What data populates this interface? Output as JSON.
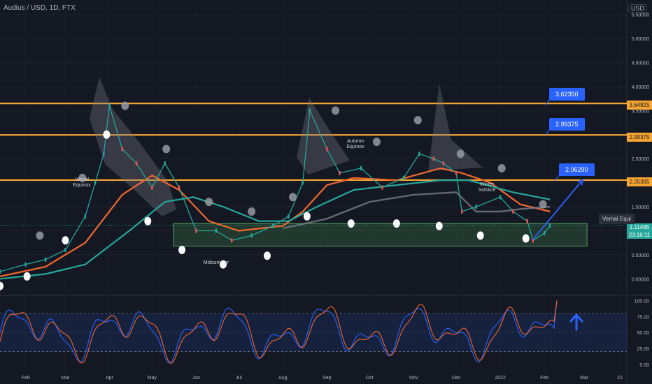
{
  "header": {
    "symbol": "Audius / USD, 1D, FTX",
    "currency": "USD"
  },
  "chart_data": [
    {
      "type": "line",
      "title": "Audius / USD, 1D, FTX",
      "x_axis": [
        "Feb",
        "Mar",
        "Apr",
        "May",
        "Jun",
        "Jul",
        "Aug",
        "Sep",
        "Oct",
        "Nov",
        "Dec",
        "2022",
        "Feb",
        "Mar",
        "22"
      ],
      "y_ticks": [
        "5.50000",
        "5.00000",
        "4.50000",
        "4.00000",
        "3.50000",
        "3.00000",
        "2.50000",
        "2.00000",
        "1.50000",
        "1.00000",
        "0.50000",
        "0.00000"
      ],
      "ylim": [
        -0.3,
        5.8
      ],
      "price": {
        "x": [
          "2021-01-14",
          "2021-02-01",
          "2021-02-15",
          "2021-03-01",
          "2021-03-15",
          "2021-03-22",
          "2021-03-28",
          "2021-04-01",
          "2021-04-10",
          "2021-04-20",
          "2021-05-01",
          "2021-05-10",
          "2021-05-20",
          "2021-06-01",
          "2021-06-15",
          "2021-06-26",
          "2021-07-10",
          "2021-07-25",
          "2021-08-05",
          "2021-08-15",
          "2021-08-20",
          "2021-09-01",
          "2021-09-10",
          "2021-09-25",
          "2021-10-10",
          "2021-10-25",
          "2021-11-05",
          "2021-11-15",
          "2021-11-22",
          "2021-12-01",
          "2021-12-05",
          "2021-12-15",
          "2022-01-01",
          "2022-01-10",
          "2022-01-20",
          "2022-01-24",
          "2022-02-01",
          "2022-02-05"
        ],
        "y": [
          0.15,
          0.3,
          0.4,
          0.6,
          1.3,
          2.0,
          2.6,
          3.6,
          2.7,
          2.4,
          1.9,
          2.4,
          1.9,
          1.0,
          1.0,
          0.8,
          0.9,
          1.1,
          1.3,
          2.0,
          3.5,
          2.7,
          2.2,
          2.3,
          1.9,
          2.1,
          2.6,
          2.5,
          2.4,
          2.2,
          1.4,
          1.5,
          1.7,
          1.4,
          1.2,
          0.8,
          0.95,
          1.11
        ]
      },
      "series": [
        {
          "color": "#f2672e",
          "x": [
            "2021-01-14",
            "2021-02-15",
            "2021-03-15",
            "2021-04-10",
            "2021-05-01",
            "2021-05-20",
            "2021-06-10",
            "2021-07-01",
            "2021-08-01",
            "2021-08-15",
            "2021-09-01",
            "2021-09-20",
            "2021-10-20",
            "2021-11-20",
            "2021-12-05",
            "2021-12-25",
            "2022-01-15",
            "2022-02-05"
          ],
          "y": [
            0.05,
            0.25,
            0.75,
            1.75,
            2.15,
            1.85,
            1.2,
            1.0,
            1.1,
            1.4,
            1.95,
            2.1,
            2.05,
            2.3,
            2.2,
            2.0,
            1.55,
            1.4
          ]
        },
        {
          "color": "#26a69a",
          "x": [
            "2021-01-14",
            "2021-02-15",
            "2021-03-15",
            "2021-04-15",
            "2021-05-10",
            "2021-05-30",
            "2021-06-20",
            "2021-07-15",
            "2021-08-05",
            "2021-08-25",
            "2021-09-20",
            "2021-10-20",
            "2021-11-20",
            "2021-12-10",
            "2022-01-10",
            "2022-02-05"
          ],
          "y": [
            0.0,
            0.1,
            0.3,
            1.0,
            1.6,
            1.7,
            1.5,
            1.2,
            1.2,
            1.5,
            1.85,
            1.95,
            2.05,
            2.05,
            1.8,
            1.65
          ]
        },
        {
          "color": "#787b86",
          "x": [
            "2021-08-01",
            "2021-09-01",
            "2021-10-01",
            "2021-11-01",
            "2021-12-01",
            "2021-12-15",
            "2022-01-01",
            "2022-01-15",
            "2022-02-05"
          ],
          "y": [
            1.05,
            1.25,
            1.6,
            1.75,
            1.8,
            1.4,
            1.4,
            1.45,
            1.5
          ]
        }
      ],
      "levels": [
        {
          "value": 3.64825,
          "label": "3.64825"
        },
        {
          "value": 2.99375,
          "label": "2.99375"
        },
        {
          "value": 2.05395,
          "label": "2.05395"
        }
      ],
      "callouts": [
        "3.62350",
        "2.99375",
        "2.06290"
      ],
      "accumulation_zone": {
        "low": 0.68,
        "high": 1.15
      },
      "forecast_arrow": {
        "from": [
          "2022-01-24",
          0.82
        ],
        "to": [
          "2022-02-28",
          2.06
        ]
      },
      "current_price": {
        "value": 1.11495,
        "label": "1.11495",
        "countdown": "23:16:11"
      },
      "annotations": [
        "Vernal Equinox",
        "Midsummer",
        "Autumn Equinox",
        "Winter Solstice",
        "Vernal Equi"
      ]
    },
    {
      "type": "line",
      "title": "",
      "y_ticks": [
        "100.00",
        "75.00",
        "50.00",
        "25.00",
        "0.00"
      ],
      "ylim": [
        -10,
        105
      ],
      "band": [
        20,
        80
      ],
      "series": [
        {
          "color": "#2962ff",
          "x": "same-as-price",
          "y": "stochastic-k"
        },
        {
          "color": "#f2672e",
          "x": "same-as-price",
          "y": "stochastic-d"
        }
      ],
      "last": 100
    }
  ]
}
